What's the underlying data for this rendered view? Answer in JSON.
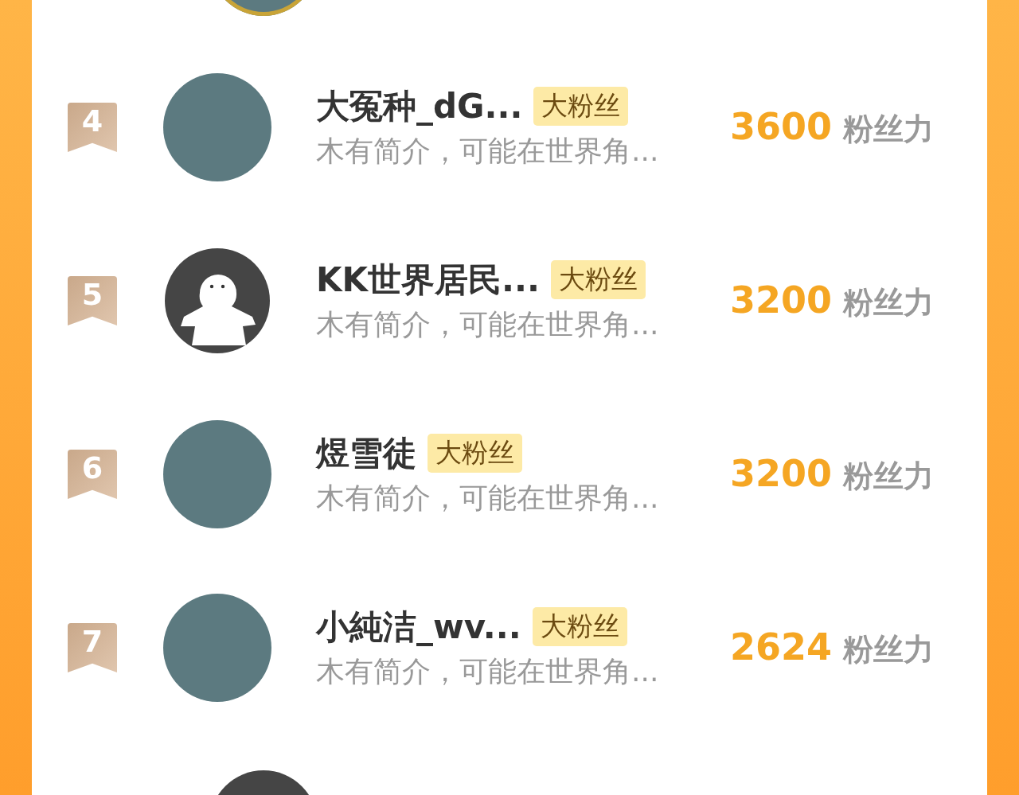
{
  "fans": [
    {
      "rank": "4",
      "name": "大冤种_dG...",
      "tag": "大粉丝",
      "bio": "木有简介，可能在世界角...",
      "score": "3600",
      "score_unit": "粉丝力",
      "kind": "picture"
    },
    {
      "rank": "5",
      "name": "KK世界居民...",
      "tag": "大粉丝",
      "bio": "木有简介，可能在世界角...",
      "score": "3200",
      "score_unit": "粉丝力",
      "kind": "default"
    },
    {
      "rank": "6",
      "name": "煜雪徒",
      "tag": "大粉丝",
      "bio": "木有简介，可能在世界角...",
      "score": "3200",
      "score_unit": "粉丝力",
      "kind": "picture"
    },
    {
      "rank": "7",
      "name": "小純洁_wv...",
      "tag": "大粉丝",
      "bio": "木有简介，可能在世界角...",
      "score": "2624",
      "score_unit": "粉丝力",
      "kind": "picture"
    }
  ]
}
